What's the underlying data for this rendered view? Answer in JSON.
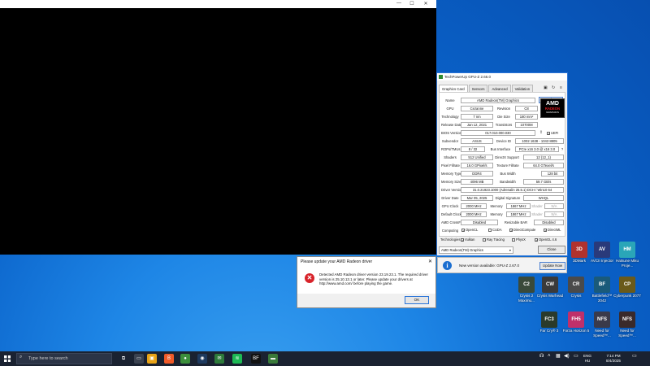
{
  "game_window": {
    "min": "—",
    "max": "☐",
    "close": "✕"
  },
  "gpuz": {
    "title": "TechPowerUp GPU-Z 2.66.0",
    "tabs": [
      "Graphics Card",
      "Sensors",
      "Advanced",
      "Validation"
    ],
    "fields": {
      "name_label": "Name",
      "name": "AMD Radeon(TM) Graphics",
      "lookup": "Lookup",
      "gpu_label": "GPU",
      "gpu": "Cezanne",
      "rev_label": "Revision",
      "rev": "C8",
      "tech_label": "Technology",
      "tech": "7 nm",
      "die_label": "Die Size",
      "die": "180 mm²",
      "rel_label": "Release Date",
      "rel": "Jan 12, 2021",
      "trans_label": "Transistors",
      "trans": "10700M",
      "bios_label": "BIOS Version",
      "bios": "017.010.000.030",
      "uefi": "UEFI",
      "sub_label": "Subvendor",
      "sub": "ASUS",
      "dev_label": "Device ID",
      "dev": "1002 1638 - 1043 8805",
      "rops_label": "ROPs/TMUs",
      "rops": "8 / 32",
      "bus_label": "Bus Interface",
      "bus": "PCIe x16 3.0 @ x16 3.0",
      "q": "?",
      "shaders_label": "Shaders",
      "shaders": "512 Unified",
      "dx_label": "DirectX Support",
      "dx": "12 (12_1)",
      "pix_label": "Pixel Fillrate",
      "pix": "16.0 GPixel/s",
      "tex_label": "Texture Fillrate",
      "tex": "64.0 GTexel/s",
      "mt_label": "Memory Type",
      "mt": "DDR4",
      "bw_label": "Bus Width",
      "bw": "128 bit",
      "ms_label": "Memory Size",
      "ms": "4096 MB",
      "band_label": "Bandwidth",
      "band": "59.7 GB/s",
      "drv_label": "Driver Version",
      "drv": "31.0.21923.1000 (Adrenalin 25.5.1) DCH / Win10 64",
      "dd_label": "Driver Date",
      "dd": "Mar 05, 2025",
      "sig_label": "Digital Signature",
      "sig": "WHQL",
      "gc_label": "GPU Clock",
      "gc": "2000 MHz",
      "mem_label": "Memory",
      "mem": "1867 MHz",
      "boost_label": "Shader",
      "boost": "N/A",
      "dc_label": "Default Clock",
      "dc": "2000 MHz",
      "mem2_label": "Memory",
      "mem2": "1867 MHz",
      "shader2_label": "Shader",
      "shader2": "N/A",
      "cf_label": "AMD CrossFire",
      "cf": "Disabled",
      "rbar_label": "Resizable BAR",
      "rbar": "Disabled",
      "comp_label": "Computing",
      "tech2_label": "Technologies"
    },
    "computing": [
      "OpenCL",
      "CUDA",
      "DirectCompute",
      "DirectML"
    ],
    "computing_checked": [
      "✓",
      "",
      "✓",
      "✓"
    ],
    "technologies": [
      "Vulkan",
      "Ray Tracing",
      "PhysX",
      "OpenGL 4.6"
    ],
    "technologies_checked": [
      "✓",
      "",
      "",
      "✓"
    ],
    "logo": {
      "brand": "AMD",
      "line": "RADEON",
      "sub": "GRAPHICS"
    },
    "gpu_select": "AMD Radeon(TM) Graphics",
    "close": "Close",
    "update_text": "New version available: GPU-Z 2.67.0",
    "update_btn": "Update Now"
  },
  "dialog": {
    "title": "Please update your AMD Radeon driver",
    "message": "Detected AMD Radeon driver version 23.19.23.1. The required driver version is 25.10.13.1 or later. Please update your drivers at http://www.amd.com/ before playing the game.",
    "ok": "OK"
  },
  "desktop_icons": [
    {
      "label": "3DMark",
      "tag": "3D",
      "color": "#b0322e"
    },
    {
      "label": "AVCII Injector",
      "tag": "AV",
      "color": "#2a3a7a"
    },
    {
      "label": "Hatsune Miku Proje...",
      "tag": "HM",
      "color": "#2aa6b8"
    },
    {
      "label": "Crysis 2 Maximu...",
      "tag": "C2",
      "color": "#3a4a3a"
    },
    {
      "label": "Crysis Warhead",
      "tag": "CW",
      "color": "#3a3a3a"
    },
    {
      "label": "Crysis",
      "tag": "CR",
      "color": "#4a4a4a"
    },
    {
      "label": "Battlefield™ 2042",
      "tag": "BF",
      "color": "#1a5a7a"
    },
    {
      "label": "Cyberpunk 2077",
      "tag": "CP",
      "color": "#6a5a1a"
    },
    {
      "label": "Far Cry® 3",
      "tag": "FC3",
      "color": "#2a3a2a"
    },
    {
      "label": "Forza Horizon 5",
      "tag": "FH5",
      "color": "#c0306a"
    },
    {
      "label": "Need for Speed™...",
      "tag": "NFS",
      "color": "#3a3a4a"
    },
    {
      "label": "Need for Speed™...",
      "tag": "NFS",
      "color": "#3a2a2a"
    }
  ],
  "taskbar": {
    "search": "Type here to search",
    "lang": "ENG",
    "lang2": "HU",
    "time": "7:14 PM",
    "date": "8/4/2025",
    "apps": [
      {
        "glyph": "⧉",
        "color": "#1a2231"
      },
      {
        "glyph": "▭",
        "color": "#3a4250"
      },
      {
        "glyph": "▣",
        "color": "#e8a317"
      },
      {
        "glyph": "B",
        "color": "#f05a28"
      },
      {
        "glyph": "●",
        "color": "#3c8f3c"
      },
      {
        "glyph": "◉",
        "color": "#1e3a5f"
      },
      {
        "glyph": "✉",
        "color": "#2d7a3a"
      },
      {
        "glyph": "≋",
        "color": "#1db954"
      },
      {
        "glyph": "BF",
        "color": "#111111"
      },
      {
        "glyph": "▬",
        "color": "#3a7a3a"
      }
    ]
  }
}
